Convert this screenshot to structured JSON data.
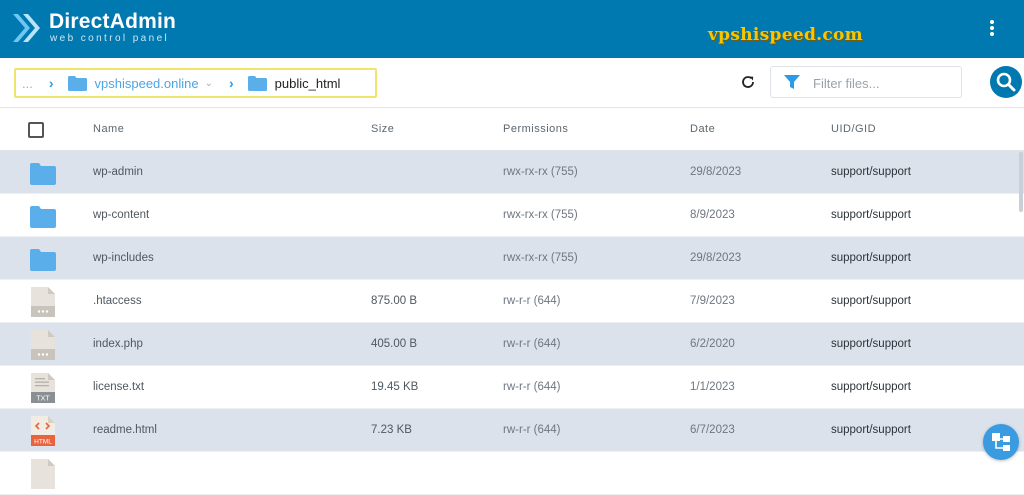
{
  "header": {
    "logo_title": "DirectAdmin",
    "logo_subtitle": "web control panel",
    "watermark": "vpshispeed.com",
    "menu_icon": "kebab-vertical-icon",
    "bg_color": "#0078b0",
    "watermark_color": "#f7c600"
  },
  "breadcrumb": {
    "ellipsis": "...",
    "items": [
      {
        "label": "vpshispeed.online",
        "icon": "folder-icon",
        "has_dropdown": true
      },
      {
        "label": "public_html",
        "icon": "folder-icon",
        "current": true
      }
    ]
  },
  "toolbar": {
    "refresh_icon": "refresh-icon",
    "filter_icon": "funnel-icon",
    "filter_placeholder": "Filter files...",
    "filter_value": "",
    "search_icon": "search-icon"
  },
  "table": {
    "columns": [
      "Name",
      "Size",
      "Permissions",
      "Date",
      "UID/GID"
    ],
    "rows": [
      {
        "name": "wp-admin",
        "type": "folder",
        "size": "",
        "permissions": "rwx-rx-rx (755)",
        "date": "29/8/2023",
        "uid": "support/support"
      },
      {
        "name": "wp-content",
        "type": "folder",
        "size": "",
        "permissions": "rwx-rx-rx (755)",
        "date": "8/9/2023",
        "uid": "support/support"
      },
      {
        "name": "wp-includes",
        "type": "folder",
        "size": "",
        "permissions": "rwx-rx-rx (755)",
        "date": "29/8/2023",
        "uid": "support/support"
      },
      {
        "name": ".htaccess",
        "type": "generic",
        "size": "875.00 B",
        "permissions": "rw-r-r (644)",
        "date": "7/9/2023",
        "uid": "support/support"
      },
      {
        "name": "index.php",
        "type": "generic",
        "size": "405.00 B",
        "permissions": "rw-r-r (644)",
        "date": "6/2/2020",
        "uid": "support/support"
      },
      {
        "name": "license.txt",
        "type": "txt",
        "badge": "TXT",
        "size": "19.45 KB",
        "permissions": "rw-r-r (644)",
        "date": "1/1/2023",
        "uid": "support/support"
      },
      {
        "name": "readme.html",
        "type": "html",
        "badge": "HTML",
        "size": "7.23 KB",
        "permissions": "rw-r-r (644)",
        "date": "6/7/2023",
        "uid": "support/support"
      }
    ]
  },
  "fab_icon": "sitemap-icon",
  "colors": {
    "folder": "#5aaee9",
    "row_shade": "#dbe2ec",
    "link": "#4aa6e8",
    "html_badge": "#e8643c",
    "txt_badge": "#8a8f94"
  }
}
